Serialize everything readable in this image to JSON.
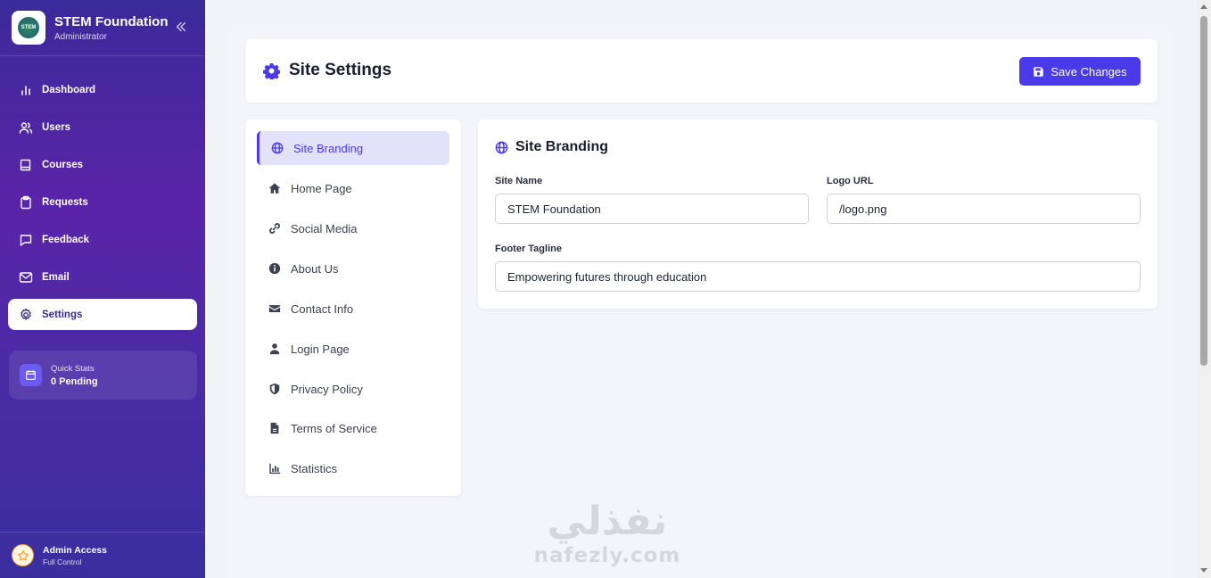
{
  "app": {
    "name": "STEM Foundation",
    "role": "Administrator",
    "logo_text": "STEM"
  },
  "sidebar": {
    "items": [
      {
        "label": "Dashboard",
        "icon": "chart-bars-icon"
      },
      {
        "label": "Users",
        "icon": "users-icon"
      },
      {
        "label": "Courses",
        "icon": "book-icon"
      },
      {
        "label": "Requests",
        "icon": "clipboard-icon"
      },
      {
        "label": "Feedback",
        "icon": "message-icon"
      },
      {
        "label": "Email",
        "icon": "mail-icon"
      },
      {
        "label": "Settings",
        "icon": "gear-icon",
        "active": true
      }
    ],
    "quick_stats": {
      "label": "Quick Stats",
      "value": "0 Pending"
    },
    "admin": {
      "title": "Admin Access",
      "subtitle": "Full Control"
    }
  },
  "header": {
    "title": "Site Settings",
    "save_label": "Save Changes"
  },
  "settings_nav": {
    "items": [
      {
        "label": "Site Branding",
        "icon": "globe-icon",
        "active": true
      },
      {
        "label": "Home Page",
        "icon": "home-icon"
      },
      {
        "label": "Social Media",
        "icon": "link-icon"
      },
      {
        "label": "About Us",
        "icon": "info-icon"
      },
      {
        "label": "Contact Info",
        "icon": "envelope-icon"
      },
      {
        "label": "Login Page",
        "icon": "user-icon"
      },
      {
        "label": "Privacy Policy",
        "icon": "shield-icon"
      },
      {
        "label": "Terms of Service",
        "icon": "document-icon"
      },
      {
        "label": "Statistics",
        "icon": "bar-chart-icon"
      }
    ]
  },
  "branding": {
    "title": "Site Branding",
    "site_name": {
      "label": "Site Name",
      "value": "STEM Foundation"
    },
    "logo_url": {
      "label": "Logo URL",
      "value": "/logo.png"
    },
    "footer_tagline": {
      "label": "Footer Tagline",
      "value": "Empowering futures through education"
    }
  },
  "watermark": {
    "arabic": "نفذلي",
    "latin": "nafezly.com"
  },
  "colors": {
    "accent": "#4a3aea",
    "sidebar_top": "#3a2a9a",
    "sidebar_mid": "#5a24a8",
    "active_nav_bg": "#e2e3fb"
  }
}
